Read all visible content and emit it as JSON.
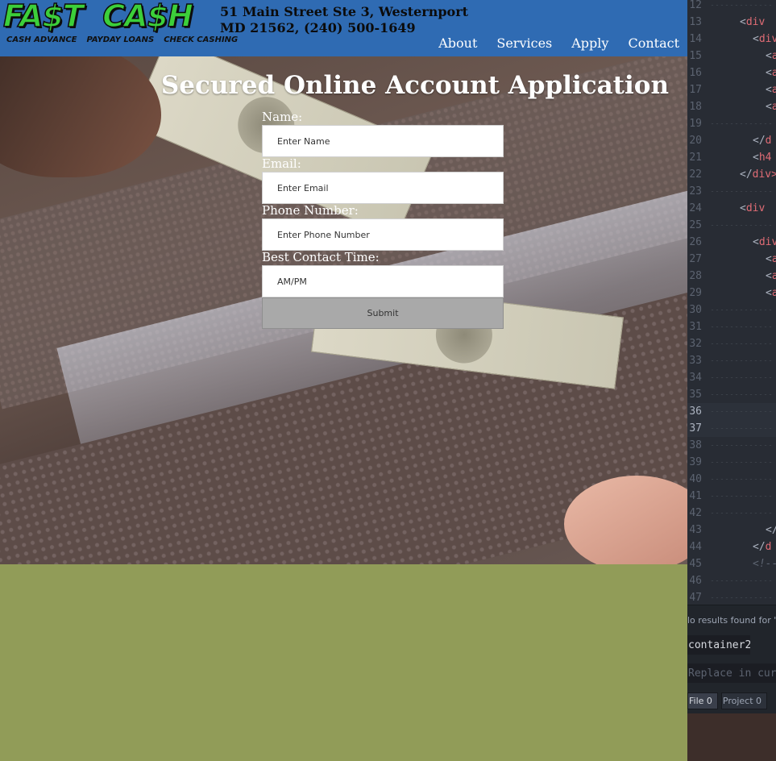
{
  "header": {
    "logo_text": "FA$T  CA$H",
    "logo_subtext": [
      "CASH ADVANCE",
      "PAYDAY LOANS",
      "CHECK CASHING"
    ],
    "address_line1": "51 Main Street Ste 3, Westernport",
    "address_line2": "MD 21562, (240) 500-1649",
    "nav": [
      "About",
      "Services",
      "Apply",
      "Contact"
    ]
  },
  "form": {
    "title": "Secured Online Account Application",
    "fields": [
      {
        "label": "Name:",
        "placeholder": "Enter Name"
      },
      {
        "label": "Email:",
        "placeholder": "Enter Email"
      },
      {
        "label": "Phone Number:",
        "placeholder": "Enter Phone Number"
      },
      {
        "label": "Best Contact Time:",
        "placeholder": "AM/PM"
      }
    ],
    "submit_label": "Submit"
  },
  "editor": {
    "lines": [
      {
        "n": "12",
        "code": ""
      },
      {
        "n": "13",
        "code": "<div"
      },
      {
        "n": "14",
        "code": "  <div"
      },
      {
        "n": "15",
        "code": "    <a"
      },
      {
        "n": "16",
        "code": "    <a"
      },
      {
        "n": "17",
        "code": "    <a"
      },
      {
        "n": "18",
        "code": "    <a"
      },
      {
        "n": "19",
        "code": ""
      },
      {
        "n": "20",
        "code": "  </d"
      },
      {
        "n": "21",
        "code": "  <h4"
      },
      {
        "n": "22",
        "code": "</div>"
      },
      {
        "n": "23",
        "code": ""
      },
      {
        "n": "24",
        "code": "<div"
      },
      {
        "n": "25",
        "code": ""
      },
      {
        "n": "26",
        "code": "  <div"
      },
      {
        "n": "27",
        "code": "    <a"
      },
      {
        "n": "28",
        "code": "    <a"
      },
      {
        "n": "29",
        "code": "    <a"
      },
      {
        "n": "30",
        "code": ""
      },
      {
        "n": "31",
        "code": ""
      },
      {
        "n": "32",
        "code": ""
      },
      {
        "n": "33",
        "code": ""
      },
      {
        "n": "34",
        "code": ""
      },
      {
        "n": "35",
        "code": ""
      },
      {
        "n": "36",
        "code": ""
      },
      {
        "n": "37",
        "code": ""
      },
      {
        "n": "38",
        "code": ""
      },
      {
        "n": "39",
        "code": ""
      },
      {
        "n": "40",
        "code": ""
      },
      {
        "n": "41",
        "code": ""
      },
      {
        "n": "42",
        "code": ""
      },
      {
        "n": "43",
        "code": "    </"
      },
      {
        "n": "44",
        "code": "  </d"
      },
      {
        "n": "45",
        "code": "  <!--"
      },
      {
        "n": "46",
        "code": ""
      },
      {
        "n": "47",
        "code": ""
      }
    ],
    "current_lines": [
      "36",
      "37"
    ],
    "find_status": "lo results found for 'c",
    "find_value": "container2",
    "replace_placeholder": "Replace in curr",
    "scope_buttons": [
      {
        "label": "File 0",
        "active": true
      },
      {
        "label": "Project 0",
        "active": false
      }
    ]
  },
  "colors": {
    "header_bg": "#2f6bb3",
    "footer_bg": "#919c58",
    "logo_green": "#3ccf3a",
    "submit_bg": "#a9a9a9",
    "editor_bg": "#282c34"
  }
}
